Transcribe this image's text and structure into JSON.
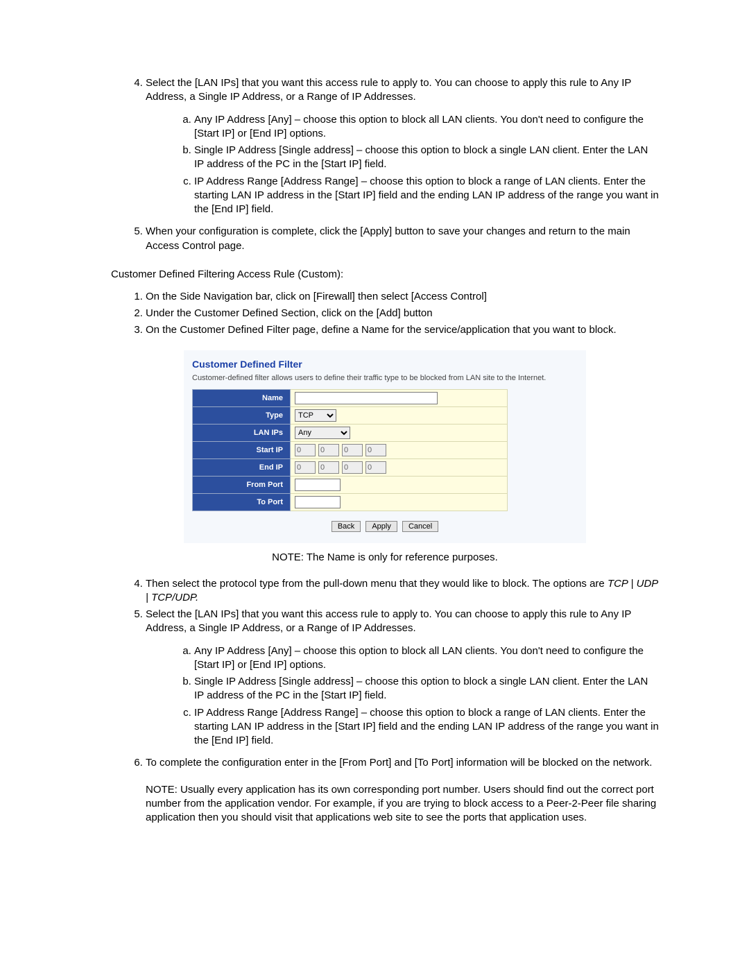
{
  "top": {
    "item4_intro": "Select the [LAN IPs] that you want this access rule to apply to. You can choose to apply this rule to Any IP Address, a Single IP Address, or a Range of IP Addresses.",
    "item4_a": "Any IP Address [Any] – choose this option to block all LAN clients.  You don't need to configure the [Start IP] or [End IP] options.",
    "item4_b": "Single IP Address [Single address] – choose this option to block a single LAN client.  Enter the LAN IP address of the PC in the [Start IP] field.",
    "item4_c": "IP Address Range [Address Range] – choose this option to block a range of LAN clients.  Enter the starting LAN IP address in the [Start IP] field and the ending LAN IP address of the range you want in the [End IP] field.",
    "item5": "When your configuration is complete, click the [Apply] button to save your changes and return to the main Access Control page."
  },
  "section_heading": "Customer Defined Filtering Access Rule (Custom):",
  "custom_steps": {
    "s1": "On the Side Navigation bar, click on [Firewall] then select [Access Control]",
    "s2": "Under the Customer Defined Section, click on the [Add] button",
    "s3": "On the Customer Defined Filter page, define a Name for the service/application that you want to block."
  },
  "screenshot": {
    "title": "Customer Defined Filter",
    "desc": "Customer-defined filter allows users to define their traffic type to be blocked from LAN site to the Internet.",
    "labels": {
      "name": "Name",
      "type": "Type",
      "lan_ips": "LAN IPs",
      "start_ip": "Start IP",
      "end_ip": "End IP",
      "from_port": "From Port",
      "to_port": "To Port"
    },
    "values": {
      "type_selected": "TCP",
      "lan_ips_selected": "Any",
      "ip_oct": "0"
    },
    "buttons": {
      "back": "Back",
      "apply": "Apply",
      "cancel": "Cancel"
    }
  },
  "caption_note": "NOTE:  The Name is only for reference purposes.",
  "lower": {
    "s4_a": "Then select the protocol type from the pull-down menu that they would like to block.  The options are ",
    "s4_b_italic": "TCP | UDP | TCP/UDP.",
    "s5_intro": "Select the [LAN IPs] that you want this access rule to apply to. You can choose to apply this rule to Any IP Address, a Single IP Address, or a Range of IP Addresses.",
    "s5_a": "Any IP Address [Any] – choose this option to block all LAN clients.  You don't need to configure the [Start IP] or [End IP] options.",
    "s5_b": "Single IP Address [Single address] – choose this option to block a single LAN client.  Enter the LAN IP address of the PC in the [Start IP] field.",
    "s5_c": "IP Address Range [Address Range] – choose this option to block a range of LAN clients.  Enter the starting LAN IP address in the [Start IP] field and the ending LAN IP address of the range you want in the [End IP] field.",
    "s6": "To complete the configuration enter in the [From Port] and [To Port] information will be blocked on the network.",
    "note": "NOTE: Usually every application has its own corresponding port number. Users should find out the correct port number from the application vendor. For example, if you are trying to block access to a Peer-2-Peer file sharing application then you should visit that applications web site to see the ports that application uses."
  }
}
